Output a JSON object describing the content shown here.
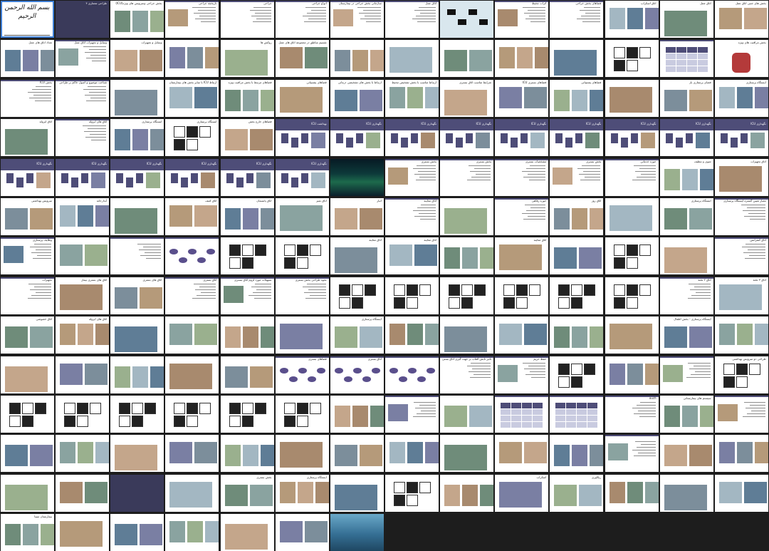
{
  "slides": [
    {
      "n": 1,
      "kind": "calligraphy",
      "title": "بسم الله الرحمن الرحیم"
    },
    {
      "n": 2,
      "kind": "dark",
      "title": "طراحی معماری ۴"
    },
    {
      "n": 3,
      "kind": "photo",
      "title": "بخش جراحی وسرویس های ویژه(ICU)"
    },
    {
      "n": 4,
      "kind": "text",
      "title": "تاریخچه جراحی"
    },
    {
      "n": 5,
      "kind": "text",
      "title": "جراحی"
    },
    {
      "n": 6,
      "kind": "text",
      "title": "انواع جراحی"
    },
    {
      "n": 7,
      "kind": "text",
      "title": "سازمانی بخش جراحی در بیمارستان"
    },
    {
      "n": 8,
      "kind": "text",
      "title": "اتاق عمل"
    },
    {
      "n": 9,
      "kind": "diagram",
      "title": ""
    },
    {
      "n": 10,
      "kind": "text",
      "title": "اثرات محیط"
    },
    {
      "n": 11,
      "kind": "text",
      "title": "فضاهای بخش جراحی"
    },
    {
      "n": 12,
      "kind": "photo",
      "title": "اتاق اسکراب"
    },
    {
      "n": 13,
      "kind": "photo",
      "title": "اتاق عمل"
    },
    {
      "n": 14,
      "kind": "photo",
      "title": "بخش های جنبی اتاق عمل"
    },
    {
      "n": 15,
      "kind": "photo",
      "title": "تعداد اتاق های عمل"
    },
    {
      "n": 16,
      "kind": "text",
      "title": "وسایل و تجهیزات اتاق عمل"
    },
    {
      "n": 17,
      "kind": "photo",
      "title": "وسایل و تجهیزات"
    },
    {
      "n": 18,
      "kind": "photo",
      "title": ""
    },
    {
      "n": 19,
      "kind": "photo",
      "title": "روکش ها"
    },
    {
      "n": 20,
      "kind": "photo",
      "title": "تقسیم مناطق در مجموعه اتاق های عمل"
    },
    {
      "n": 21,
      "kind": "photo",
      "title": ""
    },
    {
      "n": 22,
      "kind": "photo",
      "title": ""
    },
    {
      "n": 23,
      "kind": "photo",
      "title": ""
    },
    {
      "n": 24,
      "kind": "photo",
      "title": ""
    },
    {
      "n": 25,
      "kind": "photo",
      "title": ""
    },
    {
      "n": 26,
      "kind": "plan",
      "title": ""
    },
    {
      "n": 27,
      "kind": "table",
      "title": ""
    },
    {
      "n": 28,
      "kind": "icu",
      "title": "بخش مراقبت های ویژه"
    },
    {
      "n": 29,
      "kind": "text",
      "title": "بخش ICU"
    },
    {
      "n": 30,
      "kind": "text",
      "title": "شناخت موضوع و اصول حاکم بر طراحی"
    },
    {
      "n": 31,
      "kind": "photo",
      "title": ""
    },
    {
      "n": 32,
      "kind": "photo",
      "title": "ارتباط ICU با سایر بخش های بیمارستان"
    },
    {
      "n": 33,
      "kind": "photo",
      "title": "فضاهای مرتبط با بخش مراقبت ویژه"
    },
    {
      "n": 34,
      "kind": "photo",
      "title": "فضاهای پشتیبانی"
    },
    {
      "n": 35,
      "kind": "photo",
      "title": "ارتباط با بخش های تشخیصی درمانی"
    },
    {
      "n": 36,
      "kind": "photo",
      "title": "ارتباط مناسب با بخش تشخیص محیط"
    },
    {
      "n": 37,
      "kind": "photo",
      "title": "شرایط مناسب اتاق بستری"
    },
    {
      "n": 38,
      "kind": "photo",
      "title": "فضاهای بستری ICU"
    },
    {
      "n": 39,
      "kind": "photo",
      "title": "فضاهای پشتیبانی"
    },
    {
      "n": 40,
      "kind": "photo",
      "title": ""
    },
    {
      "n": 41,
      "kind": "photo",
      "title": "فضای پرستاری باز"
    },
    {
      "n": 42,
      "kind": "photo",
      "title": "ایستگاه پرستاری"
    },
    {
      "n": 43,
      "kind": "photo",
      "title": "اتاق ایزوله"
    },
    {
      "n": 44,
      "kind": "text",
      "title": "اتاق های ایزوله"
    },
    {
      "n": 45,
      "kind": "photo",
      "title": "ایستگاه پرستاری"
    },
    {
      "n": 46,
      "kind": "plan",
      "title": "ایستگاه پرستاری"
    },
    {
      "n": 47,
      "kind": "photo",
      "title": "فضاهای خارج بخش"
    },
    {
      "n": 48,
      "kind": "purple",
      "title": "بهداشت ICU"
    },
    {
      "n": 49,
      "kind": "purple",
      "title": "نگهداری ICU"
    },
    {
      "n": 50,
      "kind": "purple",
      "title": "نگهداری ICU"
    },
    {
      "n": 51,
      "kind": "purple",
      "title": "نگهداری ICU"
    },
    {
      "n": 52,
      "kind": "purple",
      "title": "نگهداری ICU"
    },
    {
      "n": 53,
      "kind": "purple",
      "title": "نگهداری ICU"
    },
    {
      "n": 54,
      "kind": "purple",
      "title": "نگهداری ICU"
    },
    {
      "n": 55,
      "kind": "purple",
      "title": "نگهداری ICU"
    },
    {
      "n": 56,
      "kind": "purple",
      "title": "نگهداری ICU"
    },
    {
      "n": 57,
      "kind": "purple",
      "title": "نگهداری ICU"
    },
    {
      "n": 58,
      "kind": "purple",
      "title": "نگهداری ICU"
    },
    {
      "n": 59,
      "kind": "purple",
      "title": "نگهداری ICU"
    },
    {
      "n": 60,
      "kind": "purple",
      "title": "نگهداری ICU"
    },
    {
      "n": 61,
      "kind": "purple",
      "title": "نگهداری ICU"
    },
    {
      "n": 62,
      "kind": "purple",
      "title": "نگهداری ICU"
    },
    {
      "n": 63,
      "kind": "aurora",
      "title": ""
    },
    {
      "n": 64,
      "kind": "text",
      "title": "بخش بستری"
    },
    {
      "n": 65,
      "kind": "text",
      "title": "بخش بستری"
    },
    {
      "n": 66,
      "kind": "text",
      "title": "مشخصات بستری"
    },
    {
      "n": 67,
      "kind": "text",
      "title": "بخش بستری"
    },
    {
      "n": 68,
      "kind": "text",
      "title": "حوزه خدماتی"
    },
    {
      "n": 69,
      "kind": "photo",
      "title": "شوی و تنظیف"
    },
    {
      "n": 70,
      "kind": "photo",
      "title": "اتاق تجهیزات"
    },
    {
      "n": 71,
      "kind": "photo",
      "title": "سرویس بهداشتی"
    },
    {
      "n": 72,
      "kind": "photo",
      "title": "آبدارخانه"
    },
    {
      "n": 73,
      "kind": "photo",
      "title": ""
    },
    {
      "n": 74,
      "kind": "photo",
      "title": "اتاق کثیف"
    },
    {
      "n": 75,
      "kind": "photo",
      "title": "اتاق پانسمان"
    },
    {
      "n": 76,
      "kind": "photo",
      "title": "اتاق تمیز"
    },
    {
      "n": 77,
      "kind": "photo",
      "title": "انبار"
    },
    {
      "n": 78,
      "kind": "text",
      "title": "اتاق معاینه"
    },
    {
      "n": 79,
      "kind": "photo",
      "title": ""
    },
    {
      "n": 80,
      "kind": "text",
      "title": "حوزه رفاهی"
    },
    {
      "n": 81,
      "kind": "photo",
      "title": "اتاق روز"
    },
    {
      "n": 82,
      "kind": "photo",
      "title": ""
    },
    {
      "n": 83,
      "kind": "photo",
      "title": "ایستگاه پرستاری"
    },
    {
      "n": 84,
      "kind": "text",
      "title": "معیار تعیین گستره ایستگاه پرستاری"
    },
    {
      "n": 85,
      "kind": "text",
      "title": "وظایف پرستاری"
    },
    {
      "n": 86,
      "kind": "photo",
      "title": ""
    },
    {
      "n": 87,
      "kind": "text",
      "title": ""
    },
    {
      "n": 88,
      "kind": "bubble",
      "title": ""
    },
    {
      "n": 89,
      "kind": "plan",
      "title": ""
    },
    {
      "n": 90,
      "kind": "plan",
      "title": ""
    },
    {
      "n": 91,
      "kind": "photo",
      "title": "اتاق معاینه"
    },
    {
      "n": 92,
      "kind": "photo",
      "title": "اتاق معاینه"
    },
    {
      "n": 93,
      "kind": "photo",
      "title": ""
    },
    {
      "n": 94,
      "kind": "photo",
      "title": "اتاق معاینه"
    },
    {
      "n": 95,
      "kind": "photo",
      "title": ""
    },
    {
      "n": 96,
      "kind": "plan",
      "title": ""
    },
    {
      "n": 97,
      "kind": "photo",
      "title": ""
    },
    {
      "n": 98,
      "kind": "text",
      "title": "اتاق کنفرانس"
    },
    {
      "n": 99,
      "kind": "text",
      "title": "تجهیزات"
    },
    {
      "n": 100,
      "kind": "photo",
      "title": "اتاق های بستری بیمار"
    },
    {
      "n": 101,
      "kind": "photo",
      "title": "اتاق های بستری"
    },
    {
      "n": 102,
      "kind": "text",
      "title": "اتاق بستری"
    },
    {
      "n": 103,
      "kind": "text",
      "title": "تسهیلات مورد لزوم اتاق بستری"
    },
    {
      "n": 104,
      "kind": "text",
      "title": "نحوه طراحی بخش بستری"
    },
    {
      "n": 105,
      "kind": "plan",
      "title": ""
    },
    {
      "n": 106,
      "kind": "plan",
      "title": ""
    },
    {
      "n": 107,
      "kind": "plan",
      "title": ""
    },
    {
      "n": 108,
      "kind": "plan",
      "title": ""
    },
    {
      "n": 109,
      "kind": "plan",
      "title": ""
    },
    {
      "n": 110,
      "kind": "plan",
      "title": ""
    },
    {
      "n": 111,
      "kind": "text",
      "title": "اتاق ۲ تخته"
    },
    {
      "n": 112,
      "kind": "photo",
      "title": "اتاق ۳ تخته"
    },
    {
      "n": 113,
      "kind": "photo",
      "title": "اتاق خصوصی"
    },
    {
      "n": 114,
      "kind": "photo",
      "title": "اتاق های ایزوله"
    },
    {
      "n": 115,
      "kind": "photo",
      "title": ""
    },
    {
      "n": 116,
      "kind": "photo",
      "title": ""
    },
    {
      "n": 117,
      "kind": "photo",
      "title": ""
    },
    {
      "n": 118,
      "kind": "photo",
      "title": ""
    },
    {
      "n": 119,
      "kind": "photo",
      "title": "ایستگاه پرستاری"
    },
    {
      "n": 120,
      "kind": "photo",
      "title": ""
    },
    {
      "n": 121,
      "kind": "photo",
      "title": ""
    },
    {
      "n": 122,
      "kind": "photo",
      "title": ""
    },
    {
      "n": 123,
      "kind": "photo",
      "title": ""
    },
    {
      "n": 124,
      "kind": "photo",
      "title": ""
    },
    {
      "n": 125,
      "kind": "photo",
      "title": "ایستگاه پرستاری - بخش اطفال"
    },
    {
      "n": 126,
      "kind": "photo",
      "title": ""
    },
    {
      "n": 127,
      "kind": "photo",
      "title": ""
    },
    {
      "n": 128,
      "kind": "photo",
      "title": ""
    },
    {
      "n": 129,
      "kind": "photo",
      "title": ""
    },
    {
      "n": 130,
      "kind": "photo",
      "title": ""
    },
    {
      "n": 131,
      "kind": "photo",
      "title": ""
    },
    {
      "n": 132,
      "kind": "bubble",
      "title": "فضاهای بستری"
    },
    {
      "n": 133,
      "kind": "bubble",
      "title": "اتاق بستری"
    },
    {
      "n": 134,
      "kind": "bubble",
      "title": ""
    },
    {
      "n": 135,
      "kind": "text",
      "title": "تاثیر تابش آفتاب بر جهت گیری اتاق بستری"
    },
    {
      "n": 136,
      "kind": "text",
      "title": "حفظ حریم"
    },
    {
      "n": 137,
      "kind": "plan",
      "title": ""
    },
    {
      "n": 138,
      "kind": "photo",
      "title": ""
    },
    {
      "n": 139,
      "kind": "text",
      "title": ""
    },
    {
      "n": 140,
      "kind": "plan",
      "title": "طراحی دو سرویس بهداشتی"
    },
    {
      "n": 141,
      "kind": "plan",
      "title": ""
    },
    {
      "n": 142,
      "kind": "plan",
      "title": ""
    },
    {
      "n": 143,
      "kind": "plan",
      "title": ""
    },
    {
      "n": 144,
      "kind": "plan",
      "title": ""
    },
    {
      "n": 145,
      "kind": "plan",
      "title": ""
    },
    {
      "n": 146,
      "kind": "plan",
      "title": ""
    },
    {
      "n": 147,
      "kind": "photo",
      "title": ""
    },
    {
      "n": 148,
      "kind": "text",
      "title": ""
    },
    {
      "n": 149,
      "kind": "photo",
      "title": ""
    },
    {
      "n": 150,
      "kind": "table",
      "title": ""
    },
    {
      "n": 151,
      "kind": "table",
      "title": ""
    },
    {
      "n": 152,
      "kind": "text",
      "title": "ouch"
    },
    {
      "n": 153,
      "kind": "photo",
      "title": "سیستم های بیمارستانی"
    },
    {
      "n": 154,
      "kind": "text",
      "title": ""
    },
    {
      "n": 155,
      "kind": "photo",
      "title": ""
    },
    {
      "n": 156,
      "kind": "photo",
      "title": ""
    },
    {
      "n": 157,
      "kind": "photo",
      "title": ""
    },
    {
      "n": 158,
      "kind": "photo",
      "title": ""
    },
    {
      "n": 159,
      "kind": "photo",
      "title": ""
    },
    {
      "n": 160,
      "kind": "photo",
      "title": ""
    },
    {
      "n": 161,
      "kind": "photo",
      "title": ""
    },
    {
      "n": 162,
      "kind": "photo",
      "title": ""
    },
    {
      "n": 163,
      "kind": "photo",
      "title": ""
    },
    {
      "n": 164,
      "kind": "photo",
      "title": ""
    },
    {
      "n": 165,
      "kind": "photo",
      "title": ""
    },
    {
      "n": 166,
      "kind": "text",
      "title": ""
    },
    {
      "n": 167,
      "kind": "photo",
      "title": ""
    },
    {
      "n": 168,
      "kind": "photo",
      "title": ""
    },
    {
      "n": 169,
      "kind": "photo",
      "title": ""
    },
    {
      "n": 170,
      "kind": "photo",
      "title": ""
    },
    {
      "n": 171,
      "kind": "dark",
      "title": ""
    },
    {
      "n": 172,
      "kind": "photo",
      "title": ""
    },
    {
      "n": 173,
      "kind": "photo",
      "title": "بخش بستری"
    },
    {
      "n": 174,
      "kind": "photo",
      "title": "ایستگاه پرستاری"
    },
    {
      "n": 175,
      "kind": "photo",
      "title": ""
    },
    {
      "n": 176,
      "kind": "plan",
      "title": ""
    },
    {
      "n": 177,
      "kind": "photo",
      "title": ""
    },
    {
      "n": 178,
      "kind": "photo",
      "title": "اسکراب"
    },
    {
      "n": 179,
      "kind": "photo",
      "title": "ریکاوری"
    },
    {
      "n": 180,
      "kind": "photo",
      "title": ""
    },
    {
      "n": 181,
      "kind": "photo",
      "title": ""
    },
    {
      "n": 182,
      "kind": "photo",
      "title": ""
    },
    {
      "n": 183,
      "kind": "photo",
      "title": "بیمارستان سینا"
    },
    {
      "n": 184,
      "kind": "photo",
      "title": ""
    },
    {
      "n": 185,
      "kind": "photo",
      "title": ""
    },
    {
      "n": 186,
      "kind": "photo",
      "title": ""
    },
    {
      "n": 187,
      "kind": "photo",
      "title": ""
    },
    {
      "n": 188,
      "kind": "photo",
      "title": ""
    },
    {
      "n": 189,
      "kind": "dolphin",
      "title": ""
    }
  ],
  "selected_slide": 0,
  "colors": {
    "band": "#4e4d78",
    "selection": "#3e7fd6",
    "background": "#1d1d1d"
  }
}
